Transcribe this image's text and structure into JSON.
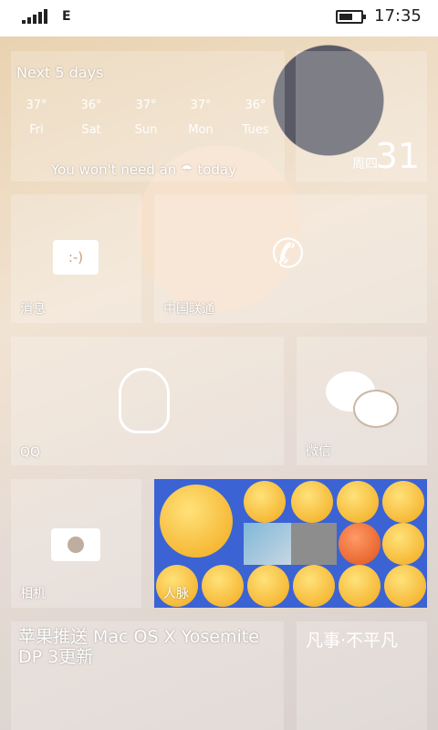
{
  "status_bar": {
    "network": "E",
    "time": "17:35"
  },
  "weather": {
    "heading": "Next 5 days",
    "days": [
      {
        "temp": "37°",
        "day": "Fri"
      },
      {
        "temp": "36°",
        "day": "Sat"
      },
      {
        "temp": "37°",
        "day": "Sun"
      },
      {
        "temp": "37°",
        "day": "Mon"
      },
      {
        "temp": "36°",
        "day": "Tues"
      }
    ],
    "note_before": "You won't need an",
    "note_after": "today"
  },
  "calendar": {
    "weekday": "周四",
    "day": "31"
  },
  "tiles": {
    "messages": "消息",
    "phone": "中国联通",
    "qq": "QQ",
    "wechat": "微信",
    "camera": "相机",
    "people": "人脉"
  },
  "news": {
    "headline": "苹果推送 Mac OS X Yosemite DP 3更新",
    "side": "凡事·不平凡"
  }
}
